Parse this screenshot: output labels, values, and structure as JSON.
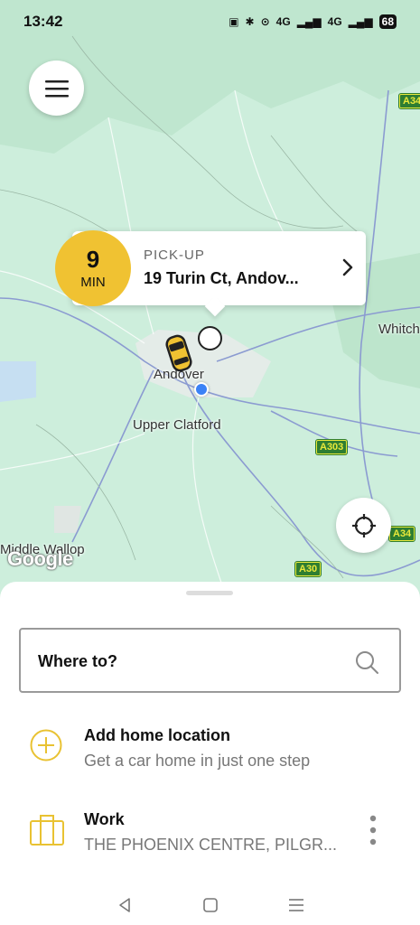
{
  "status_bar": {
    "time": "13:42",
    "signal_1": "4G",
    "signal_2": "4G",
    "battery": "68"
  },
  "map": {
    "towns": [
      {
        "name": "Andover"
      },
      {
        "name": "Upper Clatford"
      },
      {
        "name": "Whitch"
      },
      {
        "name": "Middle Wallop"
      }
    ],
    "roads": [
      {
        "name": "A34"
      },
      {
        "name": "A303"
      },
      {
        "name": "A34"
      },
      {
        "name": "A30"
      }
    ],
    "attribution": "Google"
  },
  "pickup": {
    "eta_value": "9",
    "eta_unit": "MIN",
    "label": "PICK-UP",
    "address": "19 Turin Ct, Andov..."
  },
  "search": {
    "placeholder": "Where to?"
  },
  "saved_places": [
    {
      "title": "Add home location",
      "subtitle": "Get a car home in just one step"
    },
    {
      "title": "Work",
      "subtitle": "THE PHOENIX CENTRE, PILGR..."
    }
  ],
  "colors": {
    "accent": "#f0c232",
    "map_bg": "#cdeedc",
    "location_dot": "#3b82f6"
  }
}
